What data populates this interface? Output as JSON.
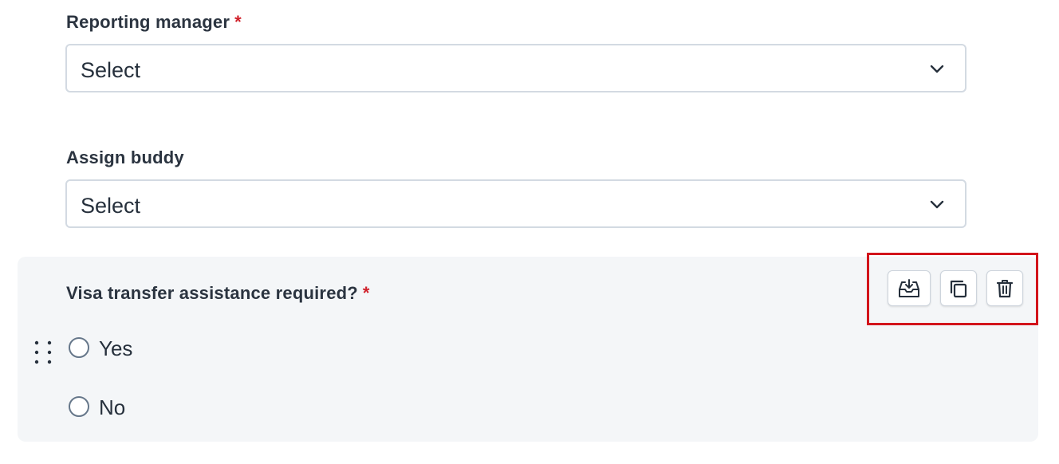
{
  "fields": {
    "reporting_manager": {
      "label": "Reporting manager",
      "required_mark": "*",
      "value": "Select"
    },
    "assign_buddy": {
      "label": "Assign buddy",
      "value": "Select"
    }
  },
  "question": {
    "label": "Visa transfer assistance required?",
    "required_mark": "*",
    "options": [
      {
        "label": "Yes",
        "selected": false
      },
      {
        "label": "No",
        "selected": false
      }
    ],
    "actions": [
      {
        "icon": "inbox-download-icon",
        "name": "save-to-library"
      },
      {
        "icon": "copy-icon",
        "name": "duplicate"
      },
      {
        "icon": "trash-icon",
        "name": "delete"
      }
    ]
  },
  "colors": {
    "required": "#d0202a",
    "highlight": "#d2141b",
    "card_background": "#f4f6f8",
    "border": "#d3dae2"
  }
}
